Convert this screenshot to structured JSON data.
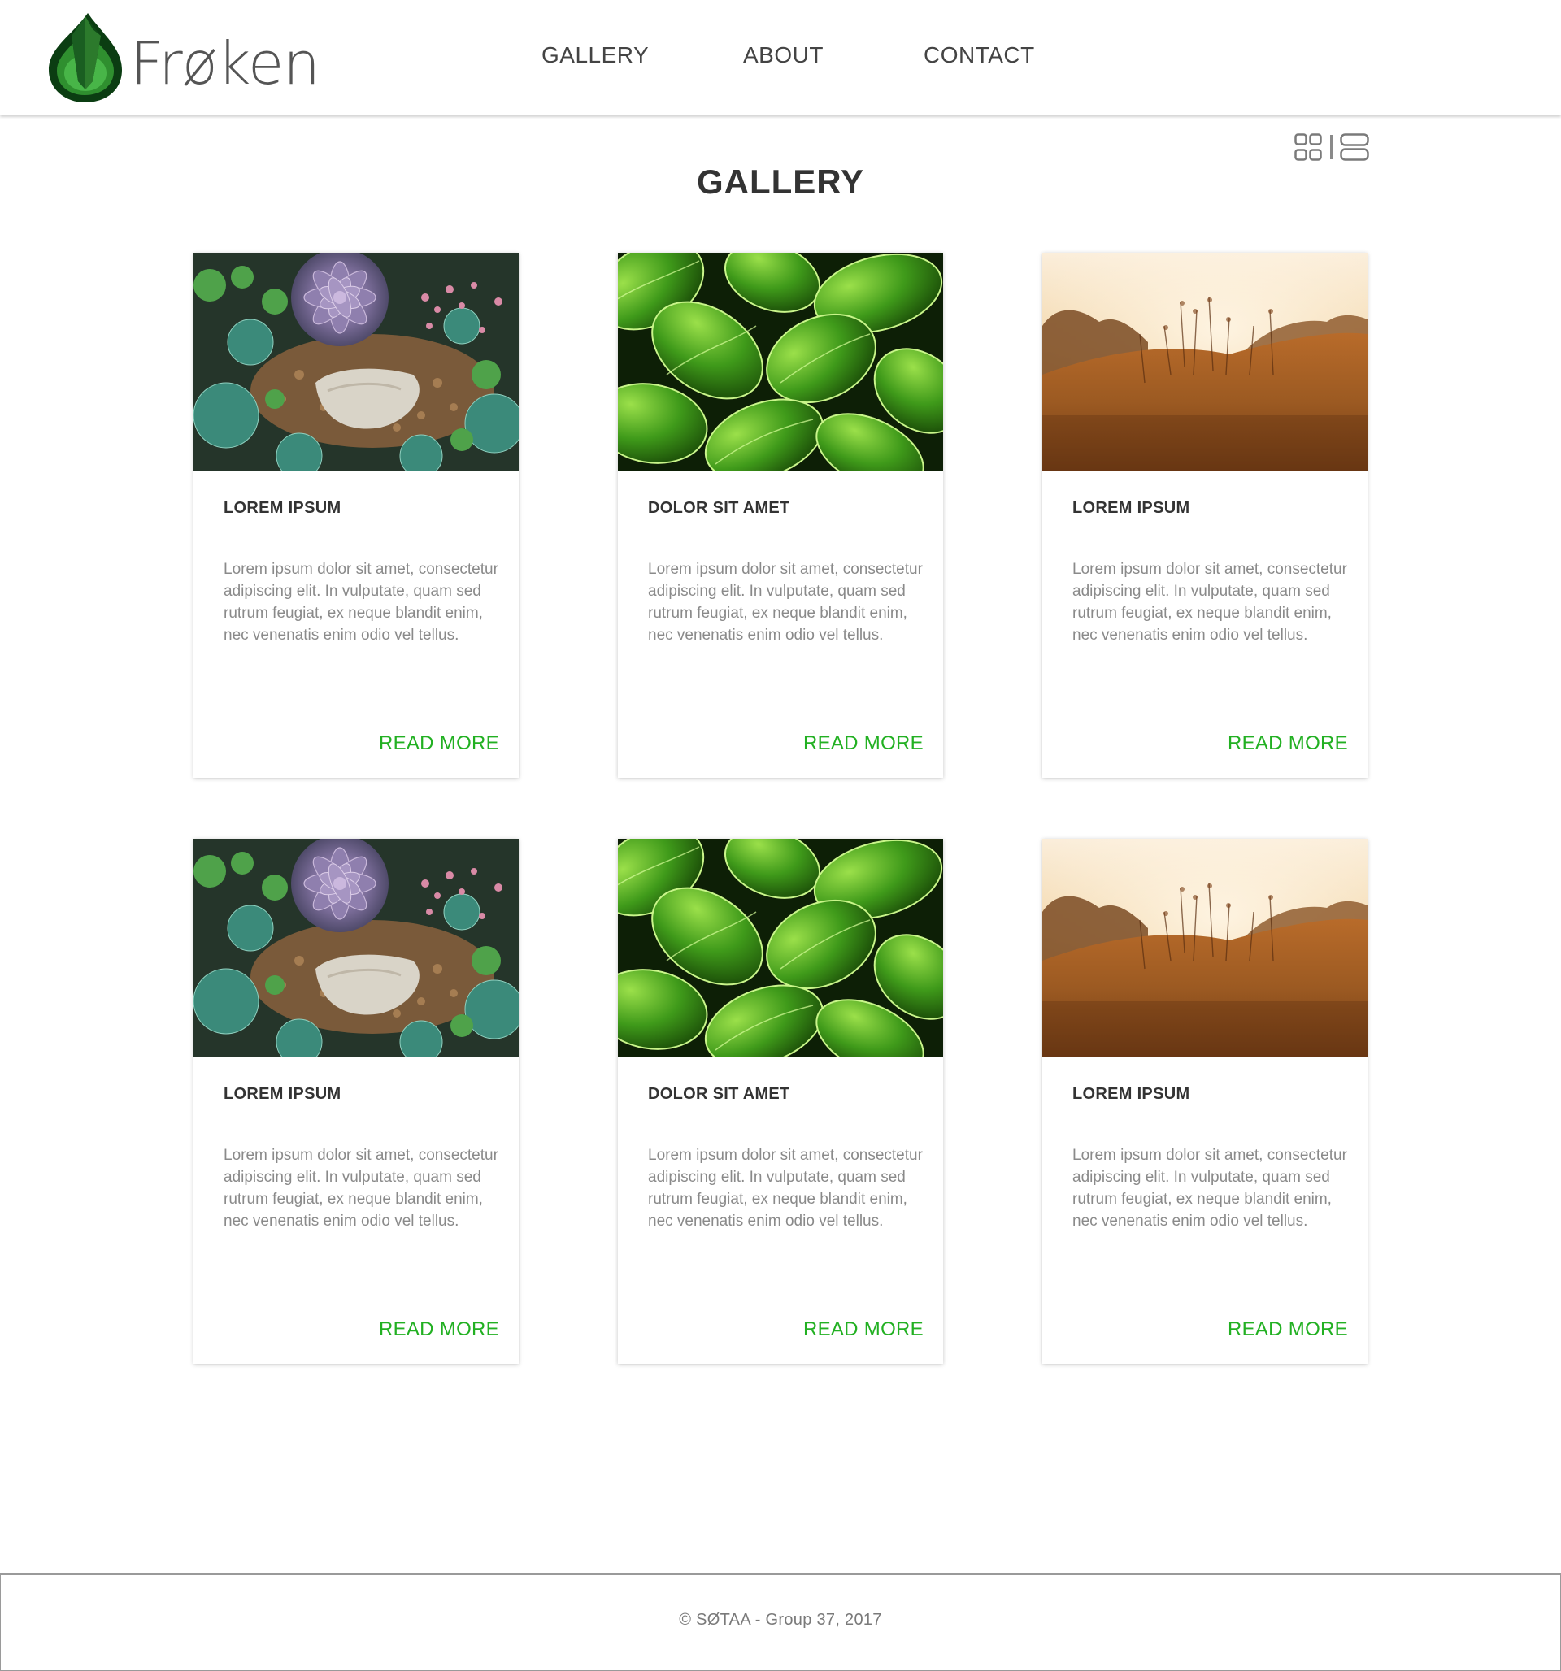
{
  "header": {
    "brand": "Frøken",
    "nav": {
      "gallery": "GALLERY",
      "about": "ABOUT",
      "contact": "CONTACT"
    }
  },
  "view_toggle": {
    "options": [
      "grid-view-icon",
      "list-view-icon"
    ]
  },
  "page": {
    "title": "GALLERY"
  },
  "cards": [
    {
      "image": "succulents",
      "title": "LOREM IPSUM",
      "text": "Lorem ipsum dolor sit amet, consectetur adipiscing elit. In vulputate, quam sed rutrum feugiat, ex neque blandit enim, nec venenatis enim odio vel tellus.",
      "link": "READ MORE"
    },
    {
      "image": "green-leaves",
      "title": "DOLOR SIT AMET",
      "text": "Lorem ipsum dolor sit amet, consectetur adipiscing elit. In vulputate, quam sed rutrum feugiat, ex neque blandit enim, nec venenatis enim odio vel tellus.",
      "link": "READ MORE"
    },
    {
      "image": "golden-field",
      "title": "LOREM IPSUM",
      "text": "Lorem ipsum dolor sit amet, consectetur adipiscing elit. In vulputate, quam sed rutrum feugiat, ex neque blandit enim, nec venenatis enim odio vel tellus.",
      "link": "READ MORE"
    },
    {
      "image": "succulents",
      "title": "LOREM IPSUM",
      "text": "Lorem ipsum dolor sit amet, consectetur adipiscing elit. In vulputate, quam sed rutrum feugiat, ex neque blandit enim, nec venenatis enim odio vel tellus.",
      "link": "READ MORE"
    },
    {
      "image": "green-leaves",
      "title": "DOLOR SIT AMET",
      "text": "Lorem ipsum dolor sit amet, consectetur adipiscing elit. In vulputate, quam sed rutrum feugiat, ex neque blandit enim, nec venenatis enim odio vel tellus.",
      "link": "READ MORE"
    },
    {
      "image": "golden-field",
      "title": "LOREM IPSUM",
      "text": "Lorem ipsum dolor sit amet, consectetur adipiscing elit. In vulputate, quam sed rutrum feugiat, ex neque blandit enim, nec venenatis enim odio vel tellus.",
      "link": "READ MORE"
    }
  ],
  "footer": {
    "text": "© SØTAA - Group 37, 2017"
  },
  "colors": {
    "accent": "#22b022",
    "logo_dark": "#0b3d12",
    "logo_mid": "#1f7a24",
    "logo_light": "#3aa53a",
    "text_dark": "#333333",
    "text_muted": "#8a8a8a"
  }
}
